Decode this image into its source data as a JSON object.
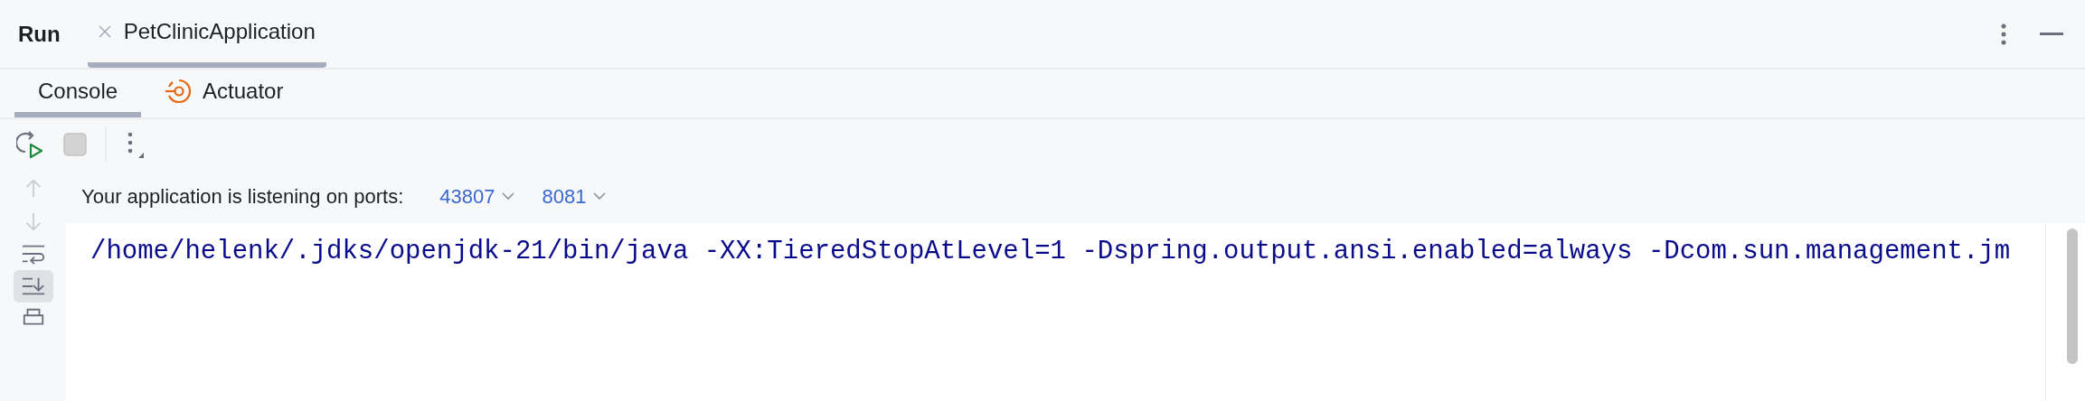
{
  "title": "Run",
  "run_tabs": [
    {
      "label": "PetClinicApplication",
      "selected": true
    }
  ],
  "tool_tabs": [
    {
      "label": "Console",
      "selected": true,
      "kind": "plain"
    },
    {
      "label": "Actuator",
      "selected": false,
      "kind": "actuator"
    }
  ],
  "toolbar": [
    {
      "kind": "rerun",
      "disabled": false
    },
    {
      "kind": "stop",
      "disabled": true
    }
  ],
  "gutter": [
    {
      "kind": "up",
      "disabled": true,
      "on": false
    },
    {
      "kind": "down",
      "disabled": true,
      "on": false
    },
    {
      "kind": "wrap",
      "disabled": false,
      "on": false
    },
    {
      "kind": "scroll-end",
      "disabled": false,
      "on": true
    },
    {
      "kind": "print",
      "disabled": false,
      "on": false
    }
  ],
  "ports_label": "Your application is listening on ports:",
  "ports": [
    "43807",
    "8081"
  ],
  "console_lines": [
    "/home/helenk/.jdks/openjdk-21/bin/java -XX:TieredStopAtLevel=1 -Dspring.output.ansi.enabled=always -Dcom.sun.management.jm"
  ]
}
